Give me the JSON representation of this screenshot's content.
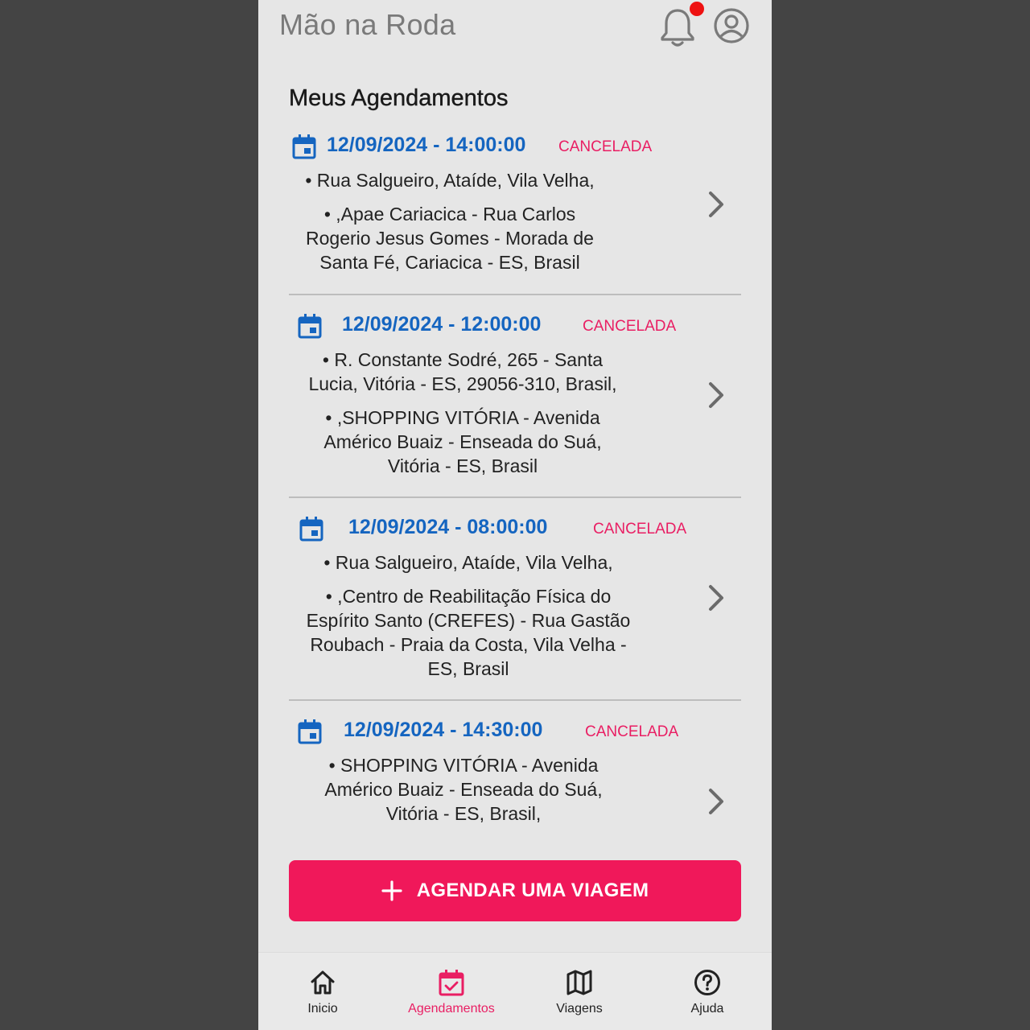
{
  "app": {
    "title": "Mão na Roda"
  },
  "header": {
    "bell_icon": "bell-icon",
    "profile_icon": "account-circle-icon",
    "has_notification": true
  },
  "section": {
    "title": "Meus Agendamentos"
  },
  "appointments": [
    {
      "datetime": "12/09/2024 - 14:00:00",
      "status": "CANCELADA",
      "origin": "• Rua Salgueiro, Ataíde, Vila Velha,",
      "destination": "• ,Apae Cariacica - Rua Carlos\nRogerio Jesus Gomes - Morada de\nSanta Fé, Cariacica - ES, Brasil"
    },
    {
      "datetime": "12/09/2024 - 12:00:00",
      "status": "CANCELADA",
      "origin": "• R. Constante Sodré, 265 - Santa\nLucia, Vitória - ES, 29056-310, Brasil,",
      "destination": "• ,SHOPPING VITÓRIA - Avenida\nAmérico Buaiz - Enseada do Suá,\nVitória - ES, Brasil"
    },
    {
      "datetime": "12/09/2024 - 08:00:00",
      "status": "CANCELADA",
      "origin": "• Rua Salgueiro, Ataíde, Vila Velha,",
      "destination": "• ,Centro de Reabilitação Física do\nEspírito Santo (CREFES) - Rua Gastão\nRoubach - Praia da Costa, Vila Velha -\nES, Brasil"
    },
    {
      "datetime": "12/09/2024 - 14:30:00",
      "status": "CANCELADA",
      "origin": "• SHOPPING VITÓRIA - Avenida\nAmérico Buaiz - Enseada do Suá,\nVitória - ES, Brasil,",
      "destination": ""
    }
  ],
  "cta": {
    "label": "AGENDAR UMA VIAGEM",
    "icon": "plus-icon"
  },
  "nav": [
    {
      "label": "Inicio",
      "icon": "home-icon",
      "active": false
    },
    {
      "label": "Agendamentos",
      "icon": "calendar-check-icon",
      "active": true
    },
    {
      "label": "Viagens",
      "icon": "map-icon",
      "active": false
    },
    {
      "label": "Ajuda",
      "icon": "help-circle-icon",
      "active": false
    }
  ],
  "colors": {
    "accent": "#f0185a",
    "date_blue": "#1565c0",
    "status_red": "#e91e63",
    "background": "#e6e6e6"
  }
}
